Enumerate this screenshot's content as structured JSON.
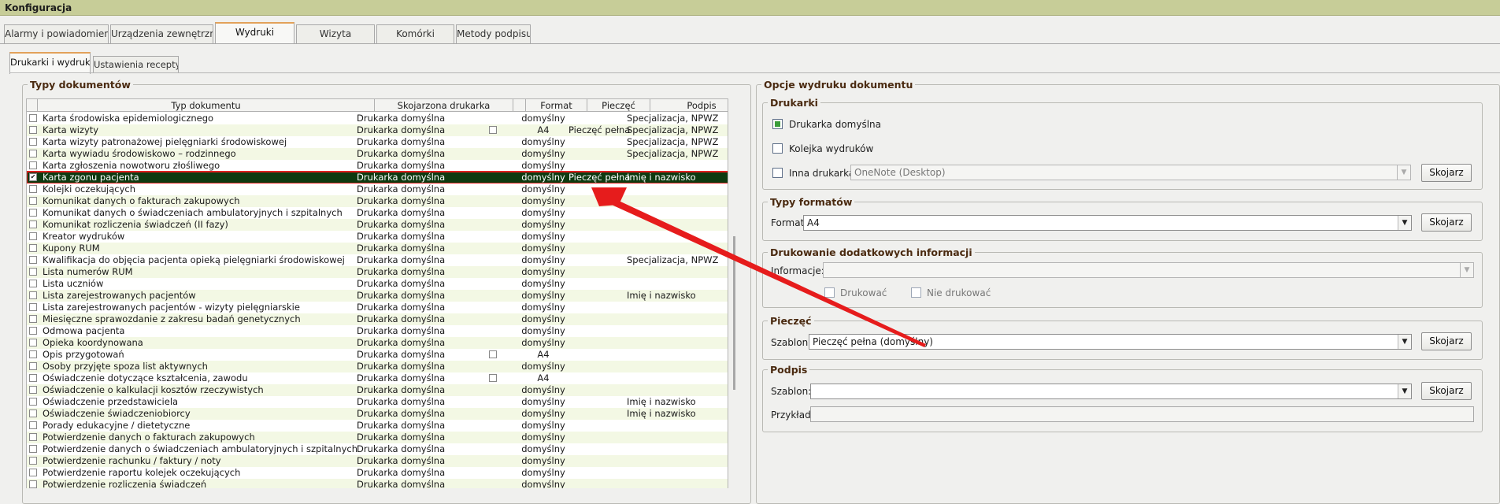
{
  "window": {
    "title": "Konfiguracja"
  },
  "tabs": [
    "Alarmy i powiadomienia",
    "Urządzenia zewnętrzne",
    "Wydruki",
    "Wizyta",
    "Komórki",
    "Metody podpisu"
  ],
  "subtabs": [
    "Drukarki i wydruki",
    "Ustawienia recepty"
  ],
  "left": {
    "legend": "Typy dokumentów",
    "columns": [
      "Typ dokumentu",
      "Skojarzona drukarka",
      "Format",
      "Pieczęć",
      "Podpis"
    ],
    "rows": [
      {
        "checked": false,
        "type": "Karta środowiska epidemiologicznego",
        "printer": "Drukarka domyślna",
        "box": false,
        "format": "domyślny",
        "stamp": "",
        "signature": "Specjalizacja, NPWZ"
      },
      {
        "checked": false,
        "type": "Karta wizyty",
        "printer": "Drukarka domyślna",
        "box": true,
        "format": "A4",
        "stamp": "Pieczęć pełna",
        "signature": "Specjalizacja, NPWZ"
      },
      {
        "checked": false,
        "type": "Karta wizyty patronażowej pielęgniarki środowiskowej",
        "printer": "Drukarka domyślna",
        "box": false,
        "format": "domyślny",
        "stamp": "",
        "signature": "Specjalizacja, NPWZ"
      },
      {
        "checked": false,
        "type": "Karta wywiadu środowiskowo – rodzinnego",
        "printer": "Drukarka domyślna",
        "box": false,
        "format": "domyślny",
        "stamp": "",
        "signature": "Specjalizacja, NPWZ"
      },
      {
        "checked": false,
        "type": "Karta zgłoszenia nowotworu złośliwego",
        "printer": "Drukarka domyślna",
        "box": false,
        "format": "domyślny",
        "stamp": "",
        "signature": ""
      },
      {
        "checked": true,
        "selected": true,
        "type": "Karta zgonu pacjenta",
        "printer": "Drukarka domyślna",
        "box": false,
        "format": "domyślny",
        "stamp": "Pieczęć pełna",
        "signature": "Imię i nazwisko"
      },
      {
        "checked": false,
        "type": "Kolejki oczekujących",
        "printer": "Drukarka domyślna",
        "box": false,
        "format": "domyślny",
        "stamp": "",
        "signature": ""
      },
      {
        "checked": false,
        "type": "Komunikat danych o fakturach zakupowych",
        "printer": "Drukarka domyślna",
        "box": false,
        "format": "domyślny",
        "stamp": "",
        "signature": ""
      },
      {
        "checked": false,
        "type": "Komunikat danych o świadczeniach ambulatoryjnych i szpitalnych",
        "printer": "Drukarka domyślna",
        "box": false,
        "format": "domyślny",
        "stamp": "",
        "signature": ""
      },
      {
        "checked": false,
        "type": "Komunikat rozliczenia świadczeń (II fazy)",
        "printer": "Drukarka domyślna",
        "box": false,
        "format": "domyślny",
        "stamp": "",
        "signature": ""
      },
      {
        "checked": false,
        "type": "Kreator wydruków",
        "printer": "Drukarka domyślna",
        "box": false,
        "format": "domyślny",
        "stamp": "",
        "signature": ""
      },
      {
        "checked": false,
        "type": "Kupony RUM",
        "printer": "Drukarka domyślna",
        "box": false,
        "format": "domyślny",
        "stamp": "",
        "signature": ""
      },
      {
        "checked": false,
        "type": "Kwalifikacja do objęcia pacjenta opieką pielęgniarki środowiskowej",
        "printer": "Drukarka domyślna",
        "box": false,
        "format": "domyślny",
        "stamp": "",
        "signature": "Specjalizacja, NPWZ"
      },
      {
        "checked": false,
        "type": "Lista numerów RUM",
        "printer": "Drukarka domyślna",
        "box": false,
        "format": "domyślny",
        "stamp": "",
        "signature": ""
      },
      {
        "checked": false,
        "type": "Lista uczniów",
        "printer": "Drukarka domyślna",
        "box": false,
        "format": "domyślny",
        "stamp": "",
        "signature": ""
      },
      {
        "checked": false,
        "type": "Lista zarejestrowanych pacjentów",
        "printer": "Drukarka domyślna",
        "box": false,
        "format": "domyślny",
        "stamp": "",
        "signature": "Imię i nazwisko"
      },
      {
        "checked": false,
        "type": "Lista zarejestrowanych pacjentów - wizyty pielęgniarskie",
        "printer": "Drukarka domyślna",
        "box": false,
        "format": "domyślny",
        "stamp": "",
        "signature": ""
      },
      {
        "checked": false,
        "type": "Miesięczne sprawozdanie z zakresu badań genetycznych",
        "printer": "Drukarka domyślna",
        "box": false,
        "format": "domyślny",
        "stamp": "",
        "signature": ""
      },
      {
        "checked": false,
        "type": "Odmowa pacjenta",
        "printer": "Drukarka domyślna",
        "box": false,
        "format": "domyślny",
        "stamp": "",
        "signature": ""
      },
      {
        "checked": false,
        "type": "Opieka koordynowana",
        "printer": "Drukarka domyślna",
        "box": false,
        "format": "domyślny",
        "stamp": "",
        "signature": ""
      },
      {
        "checked": false,
        "type": "Opis przygotowań",
        "printer": "Drukarka domyślna",
        "box": true,
        "format": "A4",
        "stamp": "",
        "signature": ""
      },
      {
        "checked": false,
        "type": "Osoby przyjęte spoza list aktywnych",
        "printer": "Drukarka domyślna",
        "box": false,
        "format": "domyślny",
        "stamp": "",
        "signature": ""
      },
      {
        "checked": false,
        "type": "Oświadczenie dotyczące kształcenia, zawodu",
        "printer": "Drukarka domyślna",
        "box": true,
        "format": "A4",
        "stamp": "",
        "signature": ""
      },
      {
        "checked": false,
        "type": "Oświadczenie o kalkulacji kosztów rzeczywistych",
        "printer": "Drukarka domyślna",
        "box": false,
        "format": "domyślny",
        "stamp": "",
        "signature": ""
      },
      {
        "checked": false,
        "type": "Oświadczenie przedstawiciela",
        "printer": "Drukarka domyślna",
        "box": false,
        "format": "domyślny",
        "stamp": "",
        "signature": "Imię i nazwisko"
      },
      {
        "checked": false,
        "type": "Oświadczenie świadczeniobiorcy",
        "printer": "Drukarka domyślna",
        "box": false,
        "format": "domyślny",
        "stamp": "",
        "signature": "Imię i nazwisko"
      },
      {
        "checked": false,
        "type": "Porady edukacyjne / dietetyczne",
        "printer": "Drukarka domyślna",
        "box": false,
        "format": "domyślny",
        "stamp": "",
        "signature": ""
      },
      {
        "checked": false,
        "type": "Potwierdzenie danych o fakturach zakupowych",
        "printer": "Drukarka domyślna",
        "box": false,
        "format": "domyślny",
        "stamp": "",
        "signature": ""
      },
      {
        "checked": false,
        "type": "Potwierdzenie danych o świadczeniach ambulatoryjnych i szpitalnych",
        "printer": "Drukarka domyślna",
        "box": false,
        "format": "domyślny",
        "stamp": "",
        "signature": ""
      },
      {
        "checked": false,
        "type": "Potwierdzenie rachunku / faktury / noty",
        "printer": "Drukarka domyślna",
        "box": false,
        "format": "domyślny",
        "stamp": "",
        "signature": ""
      },
      {
        "checked": false,
        "type": "Potwierdzenie raportu kolejek oczekujących",
        "printer": "Drukarka domyślna",
        "box": false,
        "format": "domyślny",
        "stamp": "",
        "signature": ""
      },
      {
        "checked": false,
        "type": "Potwierdzenie rozliczenia świadczeń",
        "printer": "Drukarka domyślna",
        "box": false,
        "format": "domyślny",
        "stamp": "",
        "signature": ""
      }
    ]
  },
  "right": {
    "legend": "Opcje wydruku dokumentu",
    "printers": {
      "legend": "Drukarki",
      "default_label": "Drukarka domyślna",
      "default_checked": true,
      "queue_label": "Kolejka wydruków",
      "queue_checked": false,
      "other_label": "Inna drukarka",
      "other_checked": false,
      "other_value": "OneNote (Desktop)",
      "button": "Skojarz"
    },
    "formats": {
      "legend": "Typy formatów",
      "label": "Format",
      "value": "A4",
      "button": "Skojarz"
    },
    "extra": {
      "legend": "Drukowanie dodatkowych informacji",
      "label": "Informacje:",
      "value": "",
      "print_label": "Drukować",
      "noprint_label": "Nie drukować"
    },
    "stamp": {
      "legend": "Pieczęć",
      "label": "Szablon:",
      "value": "Pieczęć pełna (domyślny)",
      "button": "Skojarz"
    },
    "signature": {
      "legend": "Podpis",
      "label": "Szablon:",
      "value": "",
      "example_label": "Przykład:",
      "example_value": "",
      "button": "Skojarz"
    }
  },
  "colors": {
    "titlebar": "#c7cd98",
    "selected_row": "#0e3a10",
    "annotation_arrow": "#e61c1c",
    "tab_accent": "#e2a25a"
  }
}
